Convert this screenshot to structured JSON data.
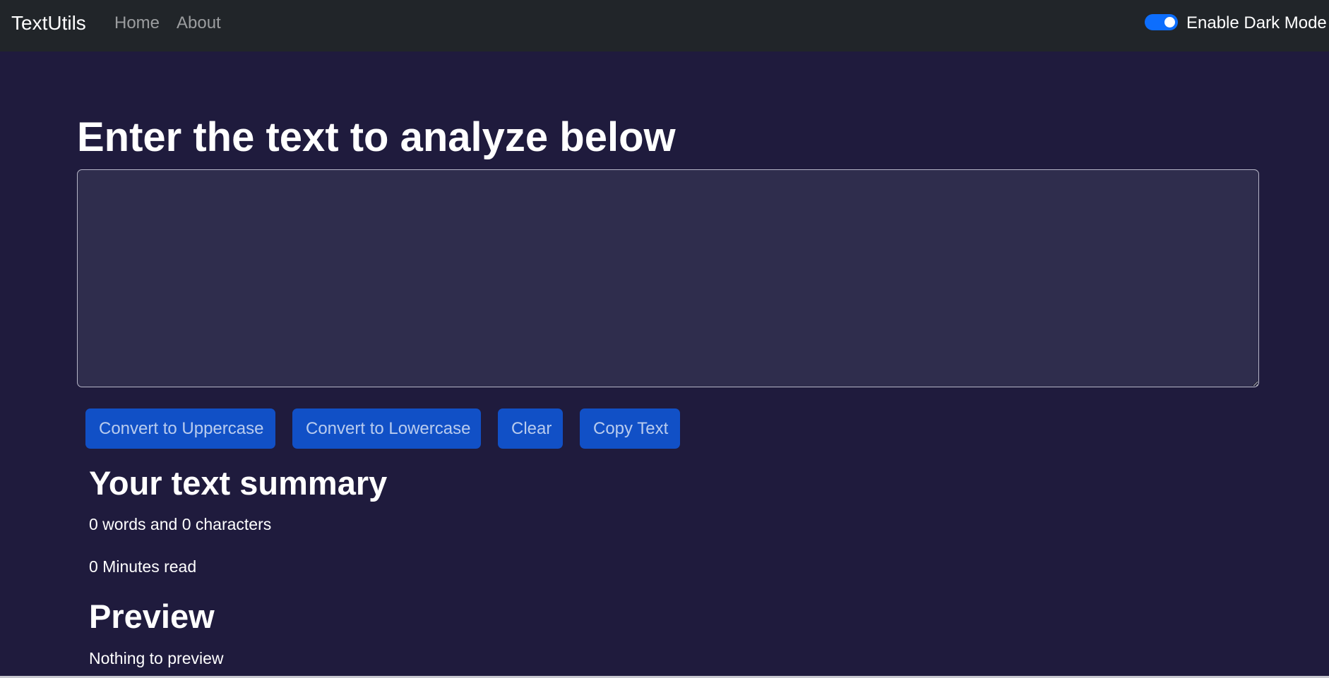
{
  "navbar": {
    "brand": "TextUtils",
    "links": [
      "Home",
      "About"
    ],
    "dark_mode_label": "Enable Dark Mode",
    "dark_mode_enabled": true
  },
  "main": {
    "heading": "Enter the text to analyze below",
    "textbox_value": "",
    "buttons": [
      "Convert to Uppercase",
      "Convert to Lowercase",
      "Clear",
      "Copy Text"
    ],
    "summary": {
      "title": "Your text summary",
      "counts": "0 words and 0 characters",
      "minutes": "0 Minutes read"
    },
    "preview": {
      "title": "Preview",
      "text": "Nothing to preview"
    }
  },
  "colors": {
    "navbar_bg": "#212529",
    "page_bg": "#1f1b3d",
    "textarea_bg": "#2f2d4d",
    "button_bg": "#1150c6",
    "switch_on": "#0d6efd"
  }
}
